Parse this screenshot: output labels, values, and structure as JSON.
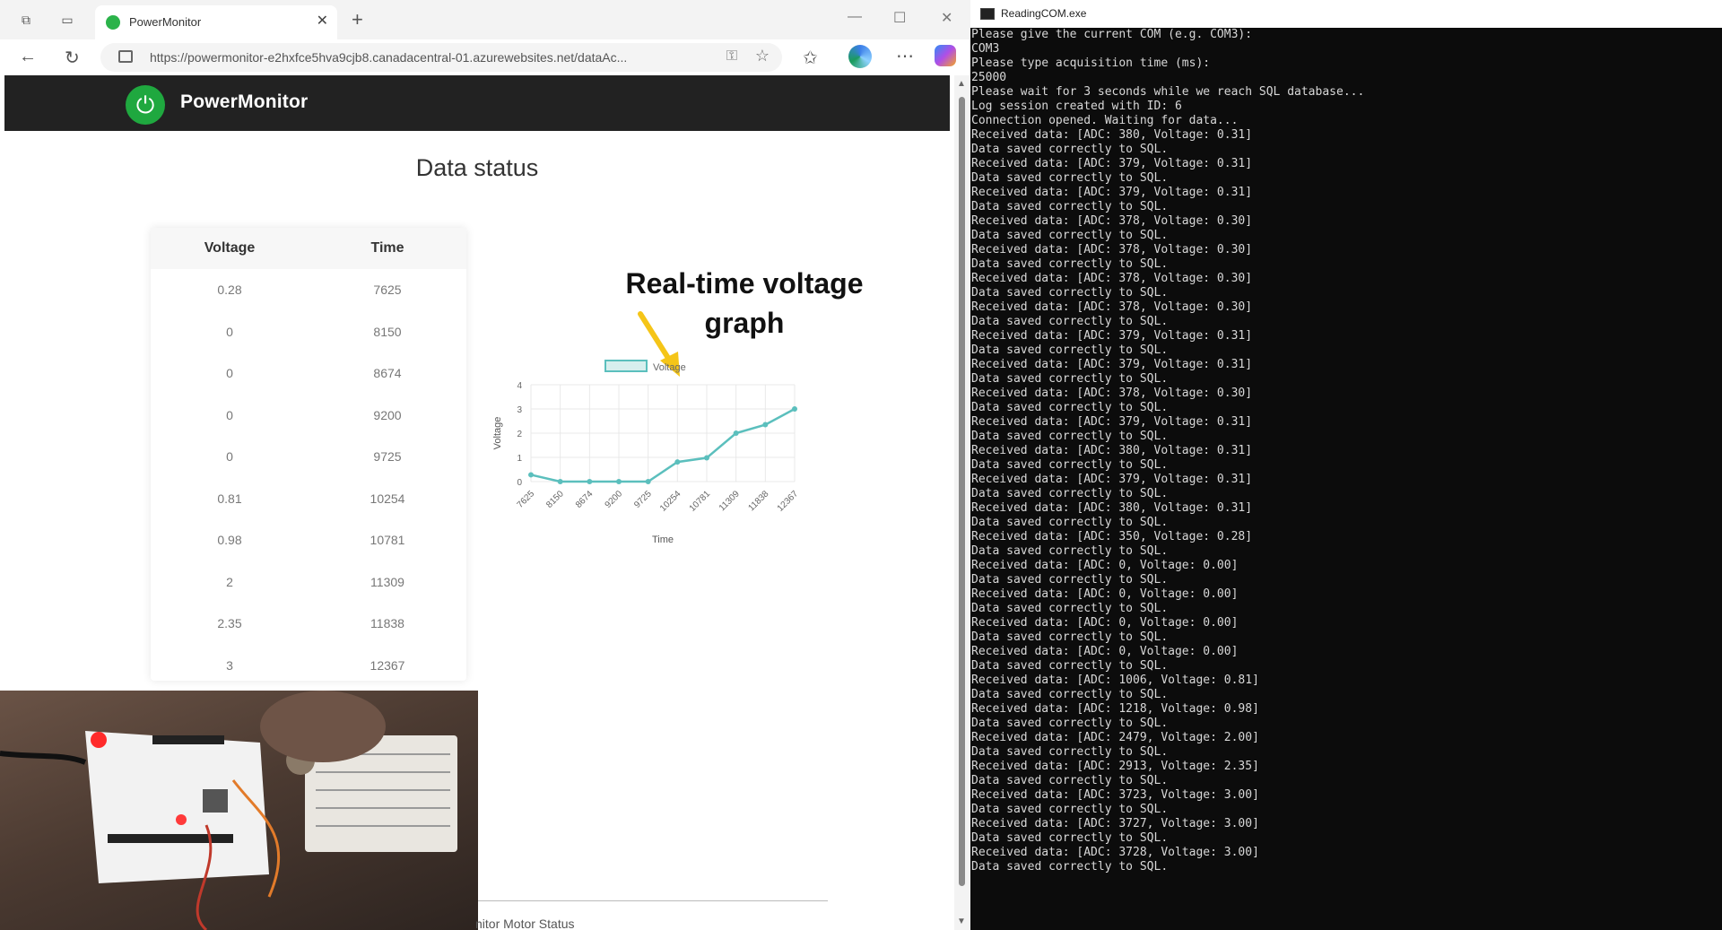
{
  "browser": {
    "tab_title": "PowerMonitor",
    "url": "https://powermonitor-e2hxfce5hva9cjb8.canadacentral-01.azurewebsites.net/dataAc..."
  },
  "app": {
    "brand": "PowerMonitor",
    "page_title": "Data status",
    "table": {
      "headers": [
        "Voltage",
        "Time"
      ],
      "rows": [
        [
          "0.28",
          "7625"
        ],
        [
          "0",
          "8150"
        ],
        [
          "0",
          "8674"
        ],
        [
          "0",
          "9200"
        ],
        [
          "0",
          "9725"
        ],
        [
          "0.81",
          "10254"
        ],
        [
          "0.98",
          "10781"
        ],
        [
          "2",
          "11309"
        ],
        [
          "2.35",
          "11838"
        ],
        [
          "3",
          "12367"
        ]
      ]
    },
    "annotation_line1": "Real-time voltage",
    "annotation_line2": "graph",
    "bottom_text": "nitor Motor Status"
  },
  "chart_data": {
    "type": "line",
    "legend": "Voltage",
    "xlabel": "Time",
    "ylabel": "Voltage",
    "x": [
      "7625",
      "8150",
      "8674",
      "9200",
      "9725",
      "10254",
      "10781",
      "11309",
      "11838",
      "12367"
    ],
    "series": [
      {
        "name": "Voltage",
        "values": [
          0.28,
          0,
          0,
          0,
          0,
          0.81,
          0.98,
          2,
          2.35,
          3
        ]
      }
    ],
    "ylim": [
      0,
      4
    ],
    "yticks": [
      0,
      1,
      2,
      3,
      4
    ],
    "grid": true,
    "color": "#5bbfbd"
  },
  "console": {
    "title": "ReadingCOM.exe",
    "lines": [
      "Please give the current COM (e.g. COM3):",
      "COM3",
      "Please type acquisition time (ms):",
      "25000",
      "Please wait for 3 seconds while we reach SQL database...",
      "Log session created with ID: 6",
      "Connection opened. Waiting for data...",
      "Received data: [ADC: 380, Voltage: 0.31]",
      "Data saved correctly to SQL.",
      "Received data: [ADC: 379, Voltage: 0.31]",
      "Data saved correctly to SQL.",
      "Received data: [ADC: 379, Voltage: 0.31]",
      "Data saved correctly to SQL.",
      "Received data: [ADC: 378, Voltage: 0.30]",
      "Data saved correctly to SQL.",
      "Received data: [ADC: 378, Voltage: 0.30]",
      "Data saved correctly to SQL.",
      "Received data: [ADC: 378, Voltage: 0.30]",
      "Data saved correctly to SQL.",
      "Received data: [ADC: 378, Voltage: 0.30]",
      "Data saved correctly to SQL.",
      "Received data: [ADC: 379, Voltage: 0.31]",
      "Data saved correctly to SQL.",
      "Received data: [ADC: 379, Voltage: 0.31]",
      "Data saved correctly to SQL.",
      "Received data: [ADC: 378, Voltage: 0.30]",
      "Data saved correctly to SQL.",
      "Received data: [ADC: 379, Voltage: 0.31]",
      "Data saved correctly to SQL.",
      "Received data: [ADC: 380, Voltage: 0.31]",
      "Data saved correctly to SQL.",
      "Received data: [ADC: 379, Voltage: 0.31]",
      "Data saved correctly to SQL.",
      "Received data: [ADC: 380, Voltage: 0.31]",
      "Data saved correctly to SQL.",
      "Received data: [ADC: 350, Voltage: 0.28]",
      "Data saved correctly to SQL.",
      "Received data: [ADC: 0, Voltage: 0.00]",
      "Data saved correctly to SQL.",
      "Received data: [ADC: 0, Voltage: 0.00]",
      "Data saved correctly to SQL.",
      "Received data: [ADC: 0, Voltage: 0.00]",
      "Data saved correctly to SQL.",
      "Received data: [ADC: 0, Voltage: 0.00]",
      "Data saved correctly to SQL.",
      "Received data: [ADC: 1006, Voltage: 0.81]",
      "Data saved correctly to SQL.",
      "Received data: [ADC: 1218, Voltage: 0.98]",
      "Data saved correctly to SQL.",
      "Received data: [ADC: 2479, Voltage: 2.00]",
      "Data saved correctly to SQL.",
      "Received data: [ADC: 2913, Voltage: 2.35]",
      "Data saved correctly to SQL.",
      "Received data: [ADC: 3723, Voltage: 3.00]",
      "Data saved correctly to SQL.",
      "Received data: [ADC: 3727, Voltage: 3.00]",
      "Data saved correctly to SQL.",
      "Received data: [ADC: 3728, Voltage: 3.00]",
      "Data saved correctly to SQL."
    ]
  }
}
